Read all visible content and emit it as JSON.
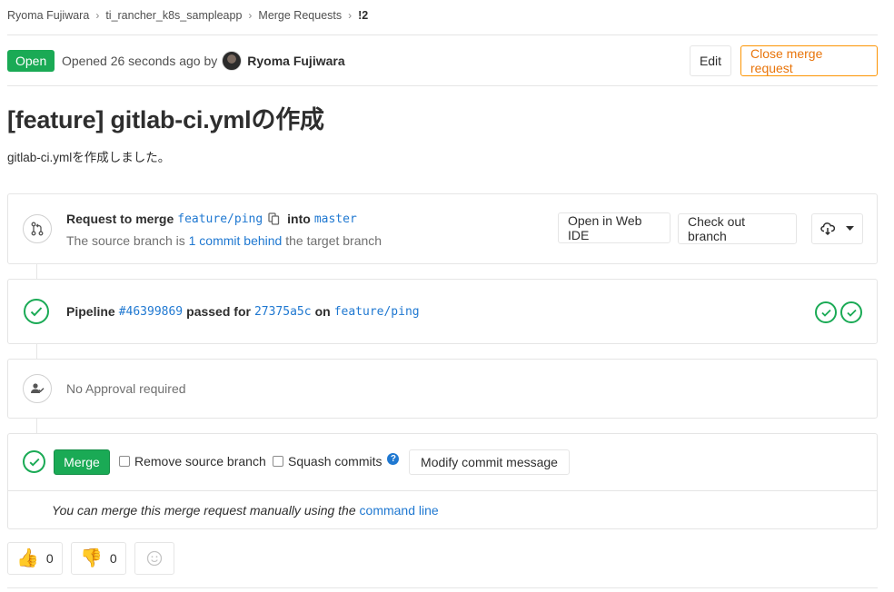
{
  "breadcrumb": {
    "items": [
      "Ryoma Fujiwara",
      "ti_rancher_k8s_sampleapp",
      "Merge Requests"
    ],
    "current": "!2",
    "separator": "›"
  },
  "header": {
    "status": "Open",
    "opened_text": "Opened 26 seconds ago by",
    "author": "Ryoma Fujiwara",
    "edit_label": "Edit",
    "close_label": "Close merge request"
  },
  "title": "[feature] gitlab-ci.ymlの作成",
  "description": "gitlab-ci.ymlを作成しました。",
  "request": {
    "label": "Request to merge",
    "source_branch": "feature/ping",
    "into": "into",
    "target_branch": "master",
    "behind_prefix": "The source branch is",
    "behind_link": "1 commit behind",
    "behind_suffix": "the target branch",
    "web_ide_label": "Open in Web IDE",
    "checkout_label": "Check out branch"
  },
  "pipeline": {
    "label": "Pipeline",
    "id": "#46399869",
    "passed_for": "passed for",
    "commit": "27375a5c",
    "on": "on",
    "branch": "feature/ping",
    "stages": [
      "passed",
      "passed"
    ]
  },
  "approval": {
    "text": "No Approval required"
  },
  "merge": {
    "merge_label": "Merge",
    "remove_source_label": "Remove source branch",
    "squash_label": "Squash commits",
    "help_glyph": "?",
    "modify_label": "Modify commit message",
    "manual_text": "You can merge this merge request manually using the",
    "command_line_label": "command line"
  },
  "awards": {
    "thumbs_up": {
      "emoji": "👍",
      "count": "0"
    },
    "thumbs_down": {
      "emoji": "👎",
      "count": "0"
    }
  },
  "colors": {
    "success": "#1aaa55",
    "link": "#1f78d1",
    "warning": "#fc9403",
    "border": "#e5e5e5"
  }
}
